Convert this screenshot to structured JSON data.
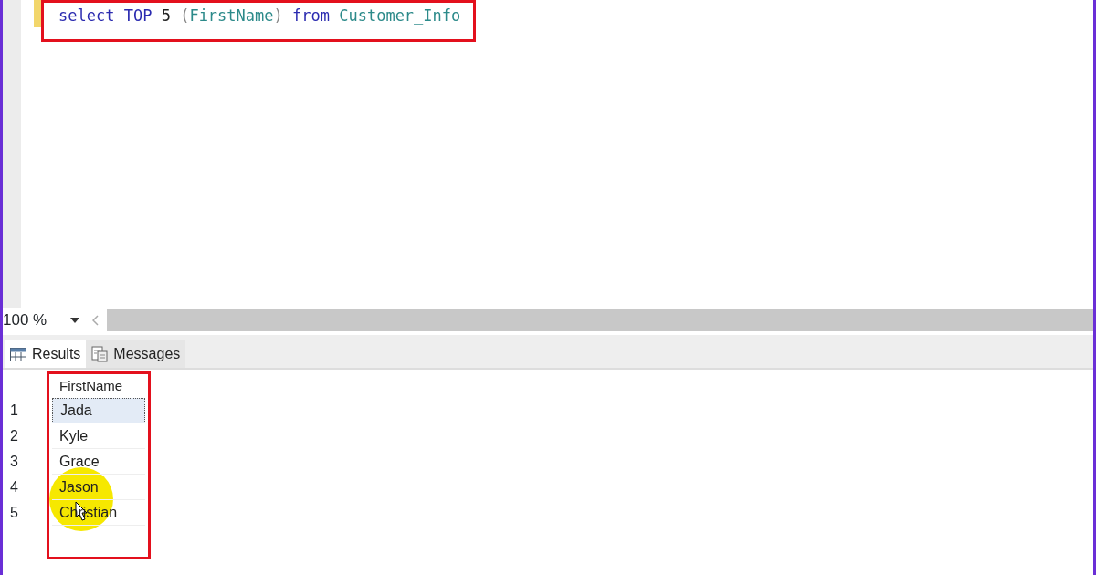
{
  "editor": {
    "query_words": [
      [
        {
          "kind": "keyword",
          "text": "select"
        }
      ],
      [
        {
          "kind": "keyword",
          "text": "TOP"
        }
      ],
      [
        {
          "kind": "number",
          "text": "5"
        }
      ],
      [
        {
          "kind": "punct",
          "text": "("
        },
        {
          "kind": "identifier",
          "text": "FirstName"
        },
        {
          "kind": "punct",
          "text": ")"
        }
      ],
      [
        {
          "kind": "keyword",
          "text": "from"
        }
      ],
      [
        {
          "kind": "identifier",
          "text": "Customer_Info"
        }
      ]
    ]
  },
  "zoom": {
    "value": "100 %"
  },
  "tabs": [
    {
      "label": "Results",
      "kind": "grid",
      "selected": true
    },
    {
      "label": "Messages",
      "kind": "messages",
      "selected": false
    }
  ],
  "results": {
    "columns": [
      "FirstName"
    ],
    "rows": [
      {
        "number": "1",
        "cells": [
          "Jada"
        ],
        "selected": true
      },
      {
        "number": "2",
        "cells": [
          "Kyle"
        ],
        "selected": false
      },
      {
        "number": "3",
        "cells": [
          "Grace"
        ],
        "selected": false
      },
      {
        "number": "4",
        "cells": [
          "Jason"
        ],
        "selected": false
      },
      {
        "number": "5",
        "cells": [
          "Christian"
        ],
        "selected": false
      }
    ]
  }
}
